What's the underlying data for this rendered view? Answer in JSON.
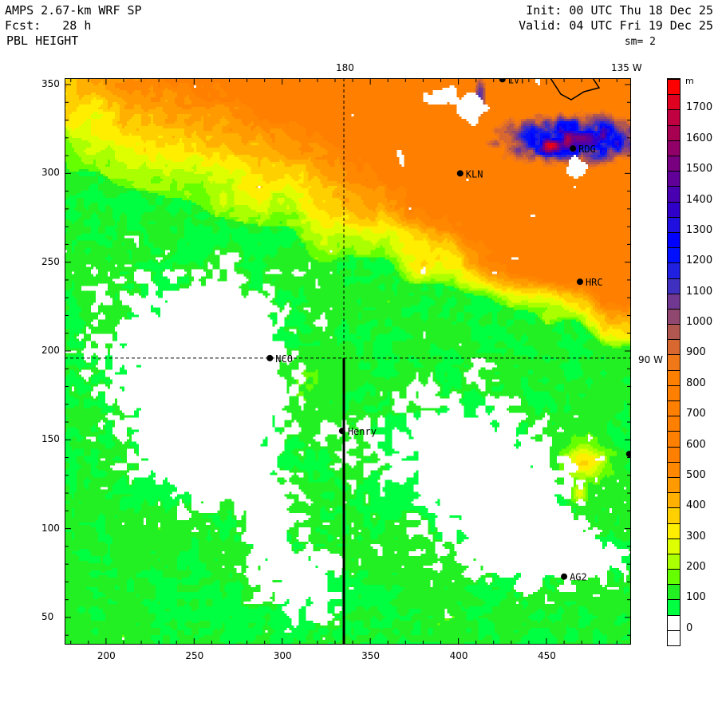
{
  "header": {
    "title": "AMPS 2.67-km WRF SP",
    "forecast": "Fcst:   28 h",
    "field": "PBL HEIGHT",
    "init": "Init: 00 UTC Thu 18 Dec 25",
    "valid": "Valid: 04 UTC Fri 19 Dec 25",
    "smoothing": "sm= 2"
  },
  "map": {
    "x_ticks": [
      "200",
      "250",
      "300",
      "350",
      "400",
      "450"
    ],
    "y_ticks": [
      "350",
      "300",
      "250",
      "200",
      "150",
      "100",
      "50"
    ],
    "x_range": [
      176.5,
      498
    ],
    "y_range": [
      34.7,
      353.6
    ],
    "lon_labels": {
      "top_180": "180",
      "top_135w": "135 W",
      "right_90w": "90 W"
    },
    "meridian_180_x": 335,
    "parallel_90w_y": 196,
    "stations": [
      {
        "name": "LVT",
        "x": 425,
        "y": 353
      },
      {
        "name": "RDG",
        "x": 465,
        "y": 314
      },
      {
        "name": "KLN",
        "x": 401,
        "y": 300
      },
      {
        "name": "HRC",
        "x": 469,
        "y": 239
      },
      {
        "name": "NCO",
        "x": 293,
        "y": 196
      },
      {
        "name": "Henry",
        "x": 334,
        "y": 155
      },
      {
        "name": "AG2",
        "x": 460,
        "y": 73
      },
      {
        "name": "",
        "x": 497,
        "y": 142
      }
    ]
  },
  "colorbar": {
    "unit": "m",
    "labels": [
      "0",
      "100",
      "200",
      "300",
      "400",
      "500",
      "600",
      "700",
      "800",
      "900",
      "1000",
      "1100",
      "1200",
      "1300",
      "1400",
      "1500",
      "1600",
      "1700"
    ],
    "colors": [
      "#ffffff",
      "#ffffff",
      "#00ff40",
      "#22f022",
      "#66ff00",
      "#aaff00",
      "#ddff00",
      "#ffee00",
      "#ffd000",
      "#ffb000",
      "#ff9a00",
      "#ff8800",
      "#ff8000",
      "#ff8000",
      "#ff8000",
      "#ff8000",
      "#ff8000",
      "#ff8000",
      "#f07818",
      "#d86830",
      "#b05850",
      "#904870",
      "#703890",
      "#4030c0",
      "#2020e0",
      "#0010ff",
      "#0000ff",
      "#2010e0",
      "#3000c8",
      "#4800b0",
      "#600098",
      "#780080",
      "#900068",
      "#a80050",
      "#c00040",
      "#e00020",
      "#ff0000"
    ]
  }
}
